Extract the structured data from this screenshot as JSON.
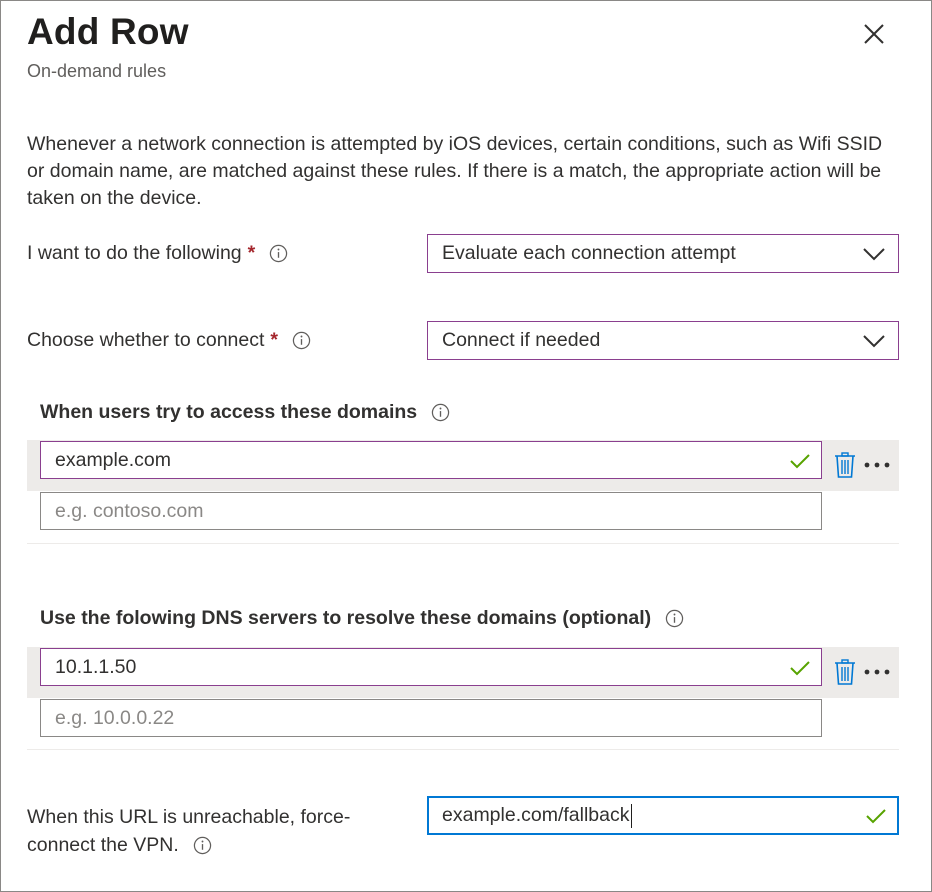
{
  "panel": {
    "title": "Add Row",
    "subtitle": "On-demand rules",
    "close_icon": "close-icon"
  },
  "description": "Whenever a network connection is attempted by iOS devices, certain conditions, such as Wifi SSID or domain name, are matched against these rules. If there is a match, the appropriate action will be taken on the device.",
  "action_field": {
    "label": "I want to do the following",
    "required_marker": "*",
    "selected": "Evaluate each connection attempt"
  },
  "connect_field": {
    "label": "Choose whether to connect",
    "required_marker": "*",
    "selected": "Connect if needed"
  },
  "domains": {
    "heading": "When users try to access these domains",
    "entries": [
      "example.com"
    ],
    "placeholder": "e.g. contoso.com"
  },
  "dns": {
    "heading": "Use the folowing DNS servers to resolve these domains (optional)",
    "entries": [
      "10.1.1.50"
    ],
    "placeholder": "e.g. 10.0.0.22"
  },
  "fallback": {
    "label_line1": "When this URL is unreachable, force-",
    "label_line2": "connect the VPN.",
    "value": "example.com/fallback"
  },
  "colors": {
    "accent_border": "#8a3f8f",
    "focus_border": "#0078d4",
    "required": "#a4262c",
    "valid_check": "#57a300",
    "delete_icon": "#0078d4"
  }
}
